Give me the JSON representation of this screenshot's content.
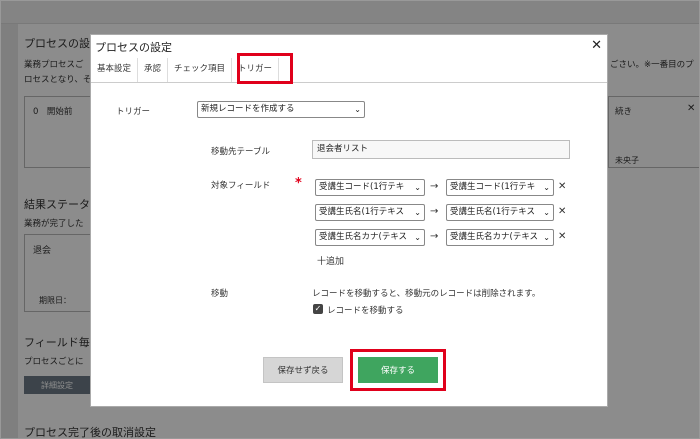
{
  "background": {
    "section1_title": "プロセスの設",
    "section1_desc_line1": "業務プロセスご",
    "section1_desc_line2": "ロセスとなり、そ",
    "section1_right_text1": "ごさい。※一番目のプ",
    "section1_right_text2": "のプロ",
    "card_left_label": "0　開始前",
    "card_right_label": "続き",
    "card_right_user": "未央子",
    "section2_title": "結果ステータ",
    "section2_desc": "業務が完了した",
    "status_box_label": "退会",
    "status_box_date_label": "期限日：",
    "section3_title": "フィールド毎",
    "section3_desc": "プロセスごとに",
    "detail_button": "詳細設定",
    "section4_title": "プロセス完了後の取消設定"
  },
  "dialog": {
    "title": "プロセスの設定",
    "close_icon": "close-icon",
    "tabs": [
      {
        "label": "基本設定"
      },
      {
        "label": "承認"
      },
      {
        "label": "チェック項目"
      },
      {
        "label": "トリガー"
      }
    ],
    "trigger_label": "トリガー",
    "trigger_value": "新規レコードを作成する",
    "dest_table_label": "移動先テーブル",
    "dest_table_value": "退会者リスト",
    "target_fields_label": "対象フィールド",
    "required_mark": "*",
    "mappings": [
      {
        "from": "受講生コード(1行テキ",
        "to": "受講生コード(1行テキ"
      },
      {
        "from": "受講生氏名(1行テキス",
        "to": "受講生氏名(1行テキス"
      },
      {
        "from": "受講生氏名カナ(テキス",
        "to": "受講生氏名カナ(テキス"
      }
    ],
    "arrow_glyph": "→",
    "remove_glyph": "✕",
    "add_label": "十追加",
    "move_label": "移動",
    "move_note": "レコードを移動すると、移動元のレコードは削除されます。",
    "move_checkbox_label": "レコードを移動する",
    "move_checkbox_checked": true,
    "cancel_button": "保存せず戻る",
    "save_button": "保存する"
  },
  "colors": {
    "save_green": "#3fa55f",
    "highlight_red": "#e0001b"
  }
}
